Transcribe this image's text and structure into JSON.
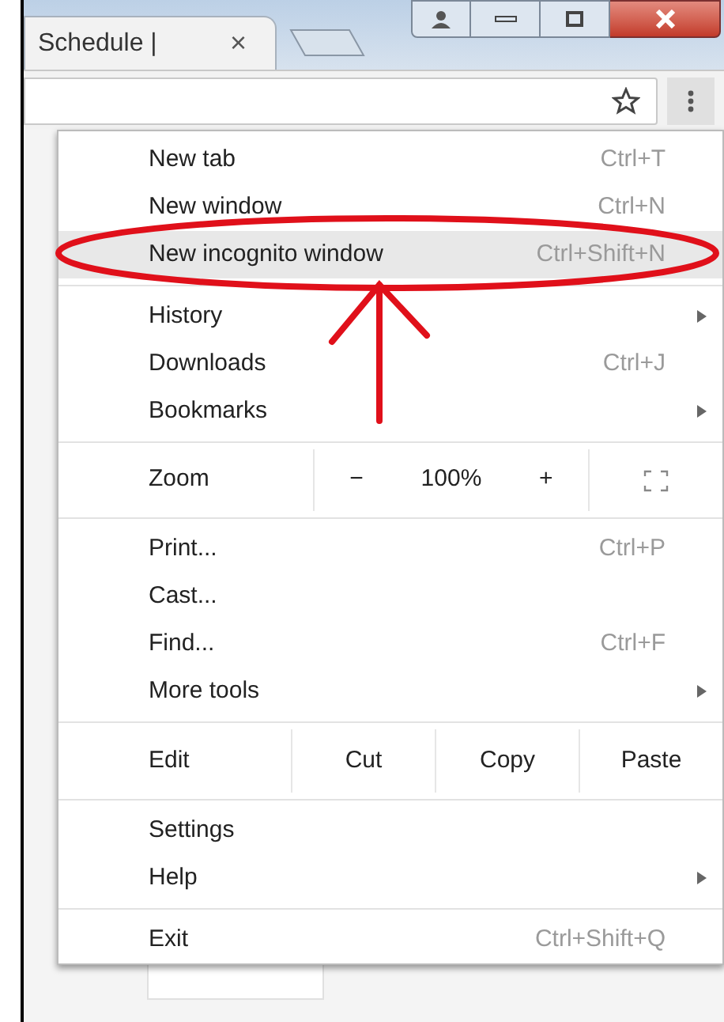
{
  "tab": {
    "title": "Schedule |",
    "close": "×"
  },
  "menu": [
    {
      "kind": "item",
      "label": "New tab",
      "shortcut": "Ctrl+T",
      "submenu": false,
      "selected": false
    },
    {
      "kind": "item",
      "label": "New window",
      "shortcut": "Ctrl+N",
      "submenu": false,
      "selected": false
    },
    {
      "kind": "item",
      "label": "New incognito window",
      "shortcut": "Ctrl+Shift+N",
      "submenu": false,
      "selected": true
    },
    {
      "kind": "separator"
    },
    {
      "kind": "item",
      "label": "History",
      "submenu": true,
      "selected": false
    },
    {
      "kind": "item",
      "label": "Downloads",
      "shortcut": "Ctrl+J",
      "submenu": false,
      "selected": false
    },
    {
      "kind": "item",
      "label": "Bookmarks",
      "submenu": true,
      "selected": false
    },
    {
      "kind": "separator"
    },
    {
      "kind": "zoom",
      "label": "Zoom",
      "minus": "−",
      "value": "100%",
      "plus": "+"
    },
    {
      "kind": "separator"
    },
    {
      "kind": "item",
      "label": "Print...",
      "shortcut": "Ctrl+P",
      "submenu": false,
      "selected": false
    },
    {
      "kind": "item",
      "label": "Cast...",
      "submenu": false,
      "selected": false
    },
    {
      "kind": "item",
      "label": "Find...",
      "shortcut": "Ctrl+F",
      "submenu": false,
      "selected": false
    },
    {
      "kind": "item",
      "label": "More tools",
      "submenu": true,
      "selected": false
    },
    {
      "kind": "separator"
    },
    {
      "kind": "edit",
      "label": "Edit",
      "actions": [
        "Cut",
        "Copy",
        "Paste"
      ]
    },
    {
      "kind": "separator"
    },
    {
      "kind": "item",
      "label": "Settings",
      "submenu": false,
      "selected": false
    },
    {
      "kind": "item",
      "label": "Help",
      "submenu": true,
      "selected": false
    },
    {
      "kind": "separator"
    },
    {
      "kind": "item",
      "label": "Exit",
      "shortcut": "Ctrl+Shift+Q",
      "submenu": false,
      "selected": false
    }
  ]
}
